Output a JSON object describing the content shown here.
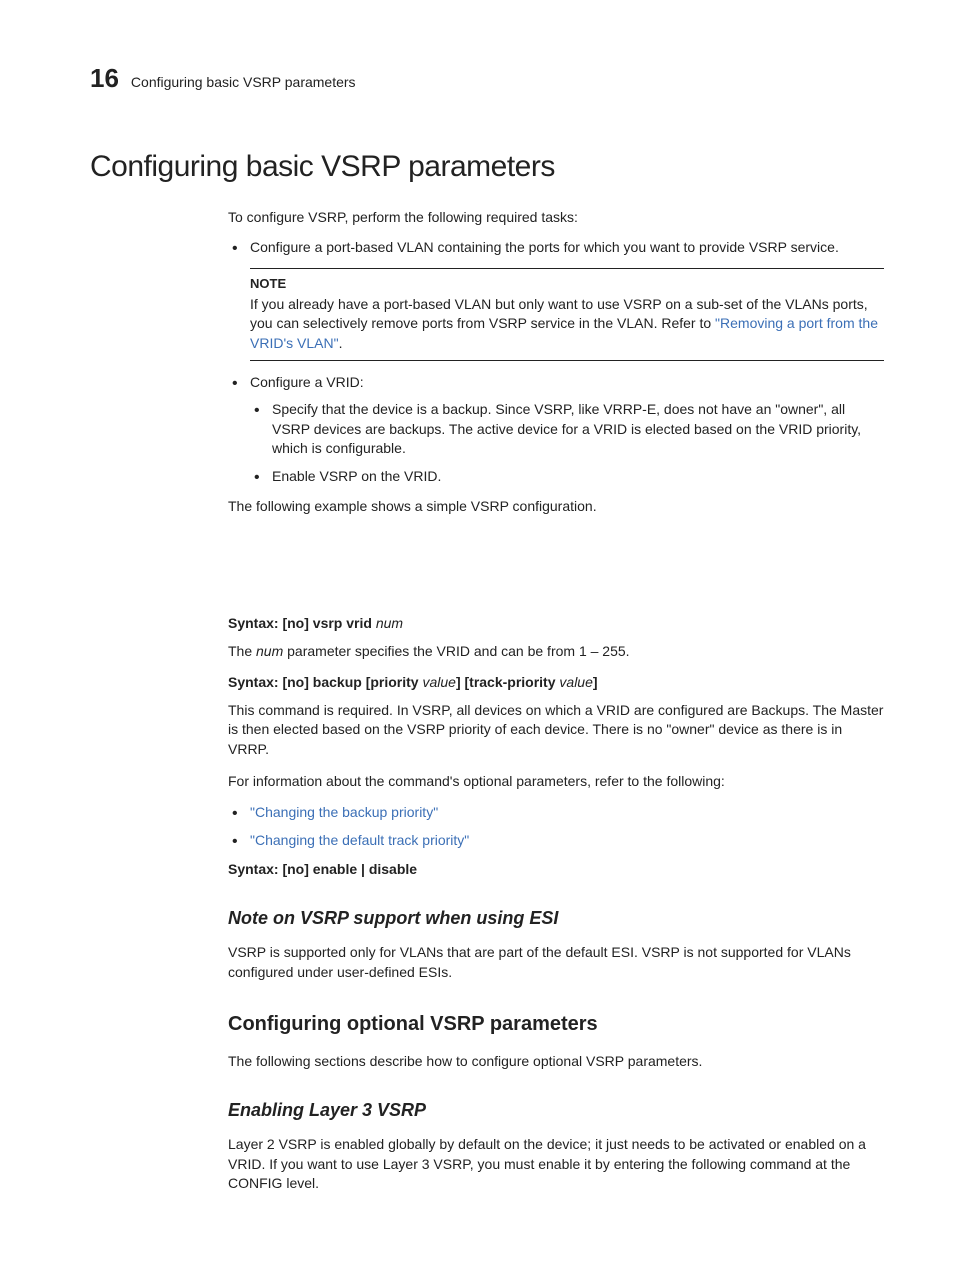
{
  "header": {
    "page_number": "16",
    "running_title": "Configuring basic VSRP parameters"
  },
  "h1": "Configuring basic VSRP parameters",
  "intro": "To configure VSRP, perform the following required tasks:",
  "bullet1": "Configure a port-based VLAN containing the ports for which you want to provide VSRP service.",
  "note": {
    "label": "NOTE",
    "text_pre": "If you already have a port-based VLAN but only want to use VSRP on a sub-set of the VLANs ports, you can selectively remove ports from VSRP service in the VLAN. Refer to ",
    "link": "\"Removing a port from the VRID's VLAN\"",
    "text_post": "."
  },
  "bullet2": "Configure a VRID:",
  "bullet2_sub1": "Specify that the device is a backup. Since VSRP, like VRRP-E, does not have an \"owner\", all VSRP devices are backups. The active device for a VRID is elected based on the VRID priority, which is configurable.",
  "bullet2_sub2": "Enable VSRP on the VRID.",
  "example_line": "The following example shows a simple VSRP configuration.",
  "syntax1_label": "Syntax:",
  "syntax1_cmd": "  [no] vsrp vrid ",
  "syntax1_arg": "num",
  "syntax1_desc_pre": "The ",
  "syntax1_desc_arg": "num",
  "syntax1_desc_post": " parameter specifies the VRID and can be from 1 – 255.",
  "syntax2_label": "Syntax:",
  "syntax2_cmd1": "  [no] backup [priority ",
  "syntax2_arg1": "value",
  "syntax2_cmd2": "]  [track-priority ",
  "syntax2_arg2": "value",
  "syntax2_cmd3": "]",
  "syntax2_desc": "This command is required. In VSRP, all devices on which a VRID are configured are Backups. The Master is then elected based on the VSRP priority of each device. There is no \"owner\" device as there is in VRRP.",
  "optional_params_intro": "For information about the command's optional parameters, refer to the following:",
  "link1": "\"Changing the backup priority\"",
  "link2": "\"Changing the default track priority\"",
  "syntax3_label": "Syntax:",
  "syntax3_cmd": "  [no] enable | disable",
  "h3_esi": "Note on VSRP support when using ESI",
  "esi_para": "VSRP is supported only for VLANs that are part of the default ESI. VSRP is not supported for VLANs configured under user-defined ESIs.",
  "h2_optional": "Configuring optional VSRP parameters",
  "optional_para": "The following sections describe how to configure optional VSRP parameters.",
  "h3_layer3": "Enabling Layer 3 VSRP",
  "layer3_para": "Layer 2 VSRP is enabled globally by default on the device; it just needs to be activated or enabled on a VRID. If you want to use Layer 3 VSRP, you must enable it by entering the following command at the CONFIG level."
}
